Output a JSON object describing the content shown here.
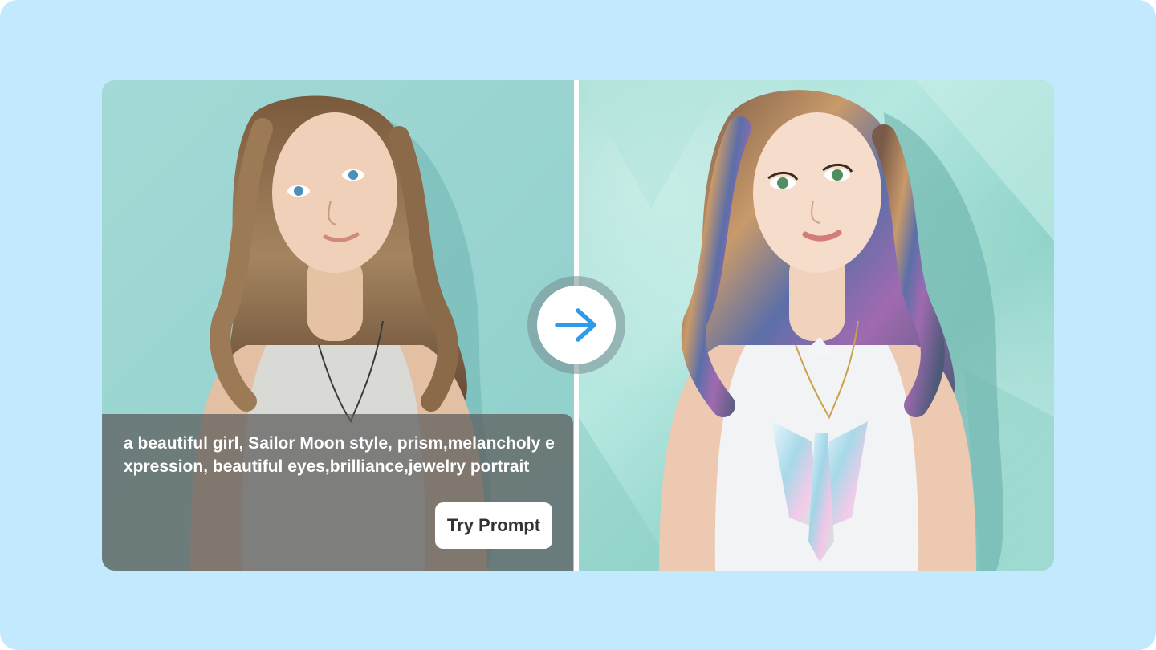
{
  "prompt": {
    "text": "a beautiful girl, Sailor Moon style, prism,melancholy expression, beautiful eyes,brilliance,jewelry portrait",
    "button_label": "Try Prompt"
  },
  "images": {
    "original": "original-portrait-photo",
    "generated": "ai-generated-prism-portrait"
  },
  "icons": {
    "convert": "arrow-right-icon"
  },
  "colors": {
    "page_background": "#c2e9fd",
    "accent": "#2f9be8",
    "overlay": "#5a5a5a",
    "button_text": "#333333"
  }
}
